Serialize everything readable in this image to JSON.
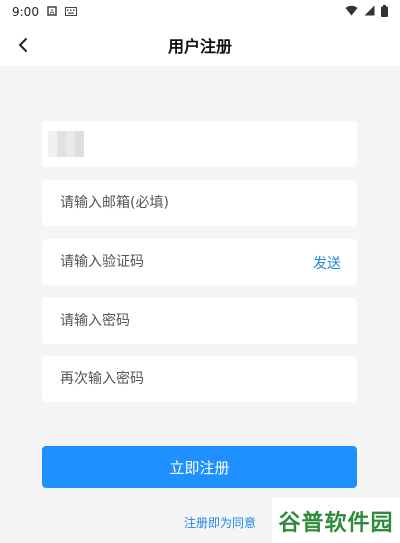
{
  "status_bar": {
    "time": "9:00"
  },
  "header": {
    "title": "用户注册"
  },
  "form": {
    "email_placeholder": "请输入邮箱(必填)",
    "code_placeholder": "请输入验证码",
    "send_label": "发送",
    "password_placeholder": "请输入密码",
    "confirm_password_placeholder": "再次输入密码"
  },
  "actions": {
    "register_label": "立即注册",
    "agreement_text": "注册即为同意"
  },
  "watermark": {
    "text": "谷普软件园"
  },
  "colors": {
    "accent": "#1e90ff",
    "link": "#1e88e5",
    "background": "#f5f5f7"
  }
}
